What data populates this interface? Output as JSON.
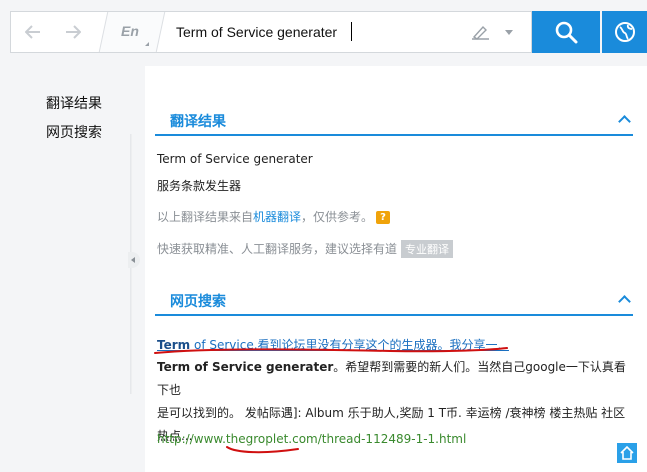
{
  "search": {
    "back_icon": "back-arrow-icon",
    "forward_icon": "forward-arrow-icon",
    "lang_label": "En",
    "query": "Term of Service generater",
    "search_icon": "magnifier-icon",
    "globe_icon": "globe-icon"
  },
  "sidebar": {
    "items": [
      {
        "label": "翻译结果"
      },
      {
        "label": "网页搜索"
      }
    ]
  },
  "translation": {
    "title": "翻译结果",
    "source": "Term of Service generater",
    "target": "服务条款发生器",
    "note_prefix": "以上翻译结果来自",
    "note_link": "机器翻译",
    "note_suffix": "，仅供参考。",
    "help_badge": "?",
    "service_text": "快速获取精准、人工翻译服务，建议选择有道",
    "service_button": "专业翻译"
  },
  "web": {
    "title": "网页搜索",
    "results": [
      {
        "title_bold": "Term",
        "title_rest": " of Service.看到论坛里没有分享这个的生成器。我分享一...",
        "snippet_bold": "Term of Service generater",
        "snippet_line1": "。希望帮到需要的新人们。当然自己google一下认真看下也",
        "snippet_line2": "是可以找到的。 发帖际遇]: Album 乐于助人,奖励 1 T币. 幸运榜 /衰神榜 楼主热贴 社区",
        "snippet_line3": "热点...",
        "url": "http://www.thegroplet.com/thread-112489-1-1.html"
      }
    ]
  },
  "colors": {
    "accent": "#1a8bdb",
    "url_green": "#3a8a2e",
    "annotation_red": "#d01010"
  }
}
